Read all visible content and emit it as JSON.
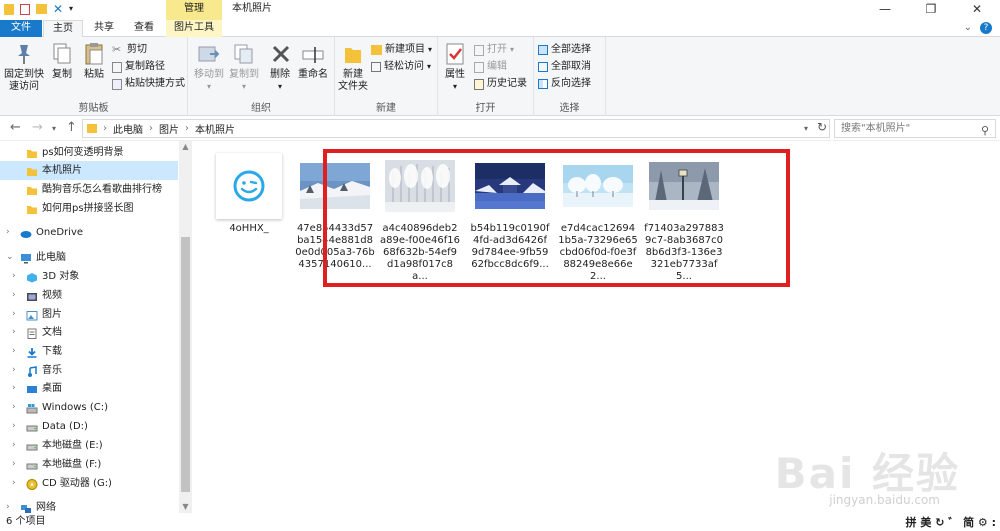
{
  "titlebar": {
    "manage_label": "管理",
    "window_title": "本机照片",
    "minimize": "—",
    "maximize": "❐",
    "close": "✕"
  },
  "tabs": {
    "file": "文件",
    "home": "主页",
    "share": "共享",
    "view": "查看",
    "picture_tools": "图片工具"
  },
  "ribbon": {
    "clipboard": {
      "label": "剪贴板",
      "pin": "固定到快\n速访问",
      "copy": "复制",
      "paste": "粘贴",
      "cut": "剪切",
      "copy_path": "复制路径",
      "paste_shortcut": "粘贴快捷方式"
    },
    "organize": {
      "label": "组织",
      "move_to": "移动到",
      "copy_to": "复制到",
      "delete": "删除",
      "rename": "重命名"
    },
    "new": {
      "label": "新建",
      "new_folder": "新建\n文件夹",
      "new_item": "新建项目",
      "easy_access": "轻松访问"
    },
    "open": {
      "label": "打开",
      "properties": "属性",
      "open": "打开",
      "edit": "编辑",
      "history": "历史记录"
    },
    "select": {
      "label": "选择",
      "select_all": "全部选择",
      "select_none": "全部取消",
      "invert": "反向选择"
    }
  },
  "address": {
    "crumbs": [
      "此电脑",
      "图片",
      "本机照片"
    ],
    "search_placeholder": "搜索\"本机照片\""
  },
  "nav": {
    "items": [
      {
        "label": "ps如何变透明背景",
        "type": "folder",
        "indent": 1,
        "selected": false
      },
      {
        "label": "本机照片",
        "type": "folder",
        "indent": 1,
        "selected": true
      },
      {
        "label": "酷狗音乐怎么看歌曲排行榜",
        "type": "folder",
        "indent": 1,
        "selected": false
      },
      {
        "label": "如何用ps拼接竖长图",
        "type": "folder",
        "indent": 1,
        "selected": false
      },
      {
        "label": "OneDrive",
        "type": "cloud",
        "indent": 0,
        "selected": false
      },
      {
        "label": "此电脑",
        "type": "pc",
        "indent": 0,
        "selected": false
      },
      {
        "label": "3D 对象",
        "type": "3d",
        "indent": 1,
        "selected": false
      },
      {
        "label": "视频",
        "type": "video",
        "indent": 1,
        "selected": false
      },
      {
        "label": "图片",
        "type": "picture",
        "indent": 1,
        "selected": false
      },
      {
        "label": "文档",
        "type": "doc",
        "indent": 1,
        "selected": false
      },
      {
        "label": "下载",
        "type": "download",
        "indent": 1,
        "selected": false
      },
      {
        "label": "音乐",
        "type": "music",
        "indent": 1,
        "selected": false
      },
      {
        "label": "桌面",
        "type": "desktop",
        "indent": 1,
        "selected": false
      },
      {
        "label": "Windows (C:)",
        "type": "drive-win",
        "indent": 1,
        "selected": false
      },
      {
        "label": "Data (D:)",
        "type": "drive",
        "indent": 1,
        "selected": false
      },
      {
        "label": "本地磁盘 (E:)",
        "type": "drive",
        "indent": 1,
        "selected": false
      },
      {
        "label": "本地磁盘 (F:)",
        "type": "drive",
        "indent": 1,
        "selected": false
      },
      {
        "label": "CD 驱动器 (G:)",
        "type": "cd",
        "indent": 1,
        "selected": false
      },
      {
        "label": "网络",
        "type": "network",
        "indent": 0,
        "selected": false
      }
    ]
  },
  "files": [
    {
      "name": "4oHHX_",
      "thumb": "smiley"
    },
    {
      "name": "47e854433d57ba1544e881d80e0d005a3-76b4357140610...",
      "thumb": "snow-hill"
    },
    {
      "name": "a4c40896deb2a89e-f00e46f1668f632b-54ef9d1a98f017c8a...",
      "thumb": "snow-trees"
    },
    {
      "name": "b54b119c0190f4fd-ad3d6426f9d784ee-9fb5962fbcc8dc6f9...",
      "thumb": "blue-pavilion"
    },
    {
      "name": "e7d4cac126941b5a-73296e65cbd06f0d-f0e3f88249e8e66e2...",
      "thumb": "white-trees"
    },
    {
      "name": "f71403a2978839c7-8ab3687c08b6d3f3-136e3321eb7733af5...",
      "thumb": "snow-lamp"
    }
  ],
  "status": {
    "count": "6 个项目",
    "ime": "拼 美 ↻ ゛ 简 ⚙ :"
  },
  "watermark": {
    "brand": "Bai 经验",
    "url": "jingyan.baidu.com"
  },
  "colors": {
    "accent": "#1979ca",
    "selected": "#cce8ff",
    "highlight": "#e02020",
    "tools_tab": "#f8e98f"
  }
}
